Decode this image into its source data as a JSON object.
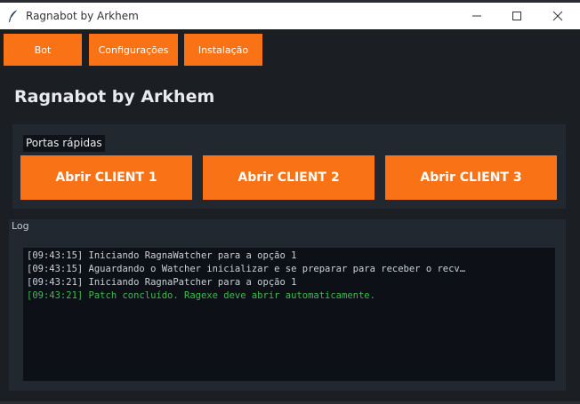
{
  "window": {
    "title": "Ragnabot by Arkhem"
  },
  "nav": {
    "bot": "Bot",
    "config": "Configurações",
    "install": "Instalação"
  },
  "main": {
    "heading": "Ragnabot by Arkhem",
    "quick_ports": {
      "label": "Portas rápidas",
      "buttons": [
        "Abrir CLIENT 1",
        "Abrir CLIENT 2",
        "Abrir CLIENT 3"
      ]
    },
    "log": {
      "label": "Log",
      "lines": [
        "[09:43:15] Iniciando RagnaWatcher para a opção 1",
        "[09:43:15] Aguardando o Watcher inicializar e se preparar para receber o recv…",
        "[09:43:21] Iniciando RagnaPatcher para a opção 1",
        "[09:43:21] Patch concluído. Ragexe deve abrir automaticamente."
      ]
    }
  },
  "colors": {
    "accent": "#f97316",
    "success_text": "#3fb950",
    "log_text": "#c9d1d9"
  },
  "icons": {
    "app": "feather-icon",
    "minimize": "minimize-icon",
    "maximize": "maximize-icon",
    "close": "close-icon"
  }
}
